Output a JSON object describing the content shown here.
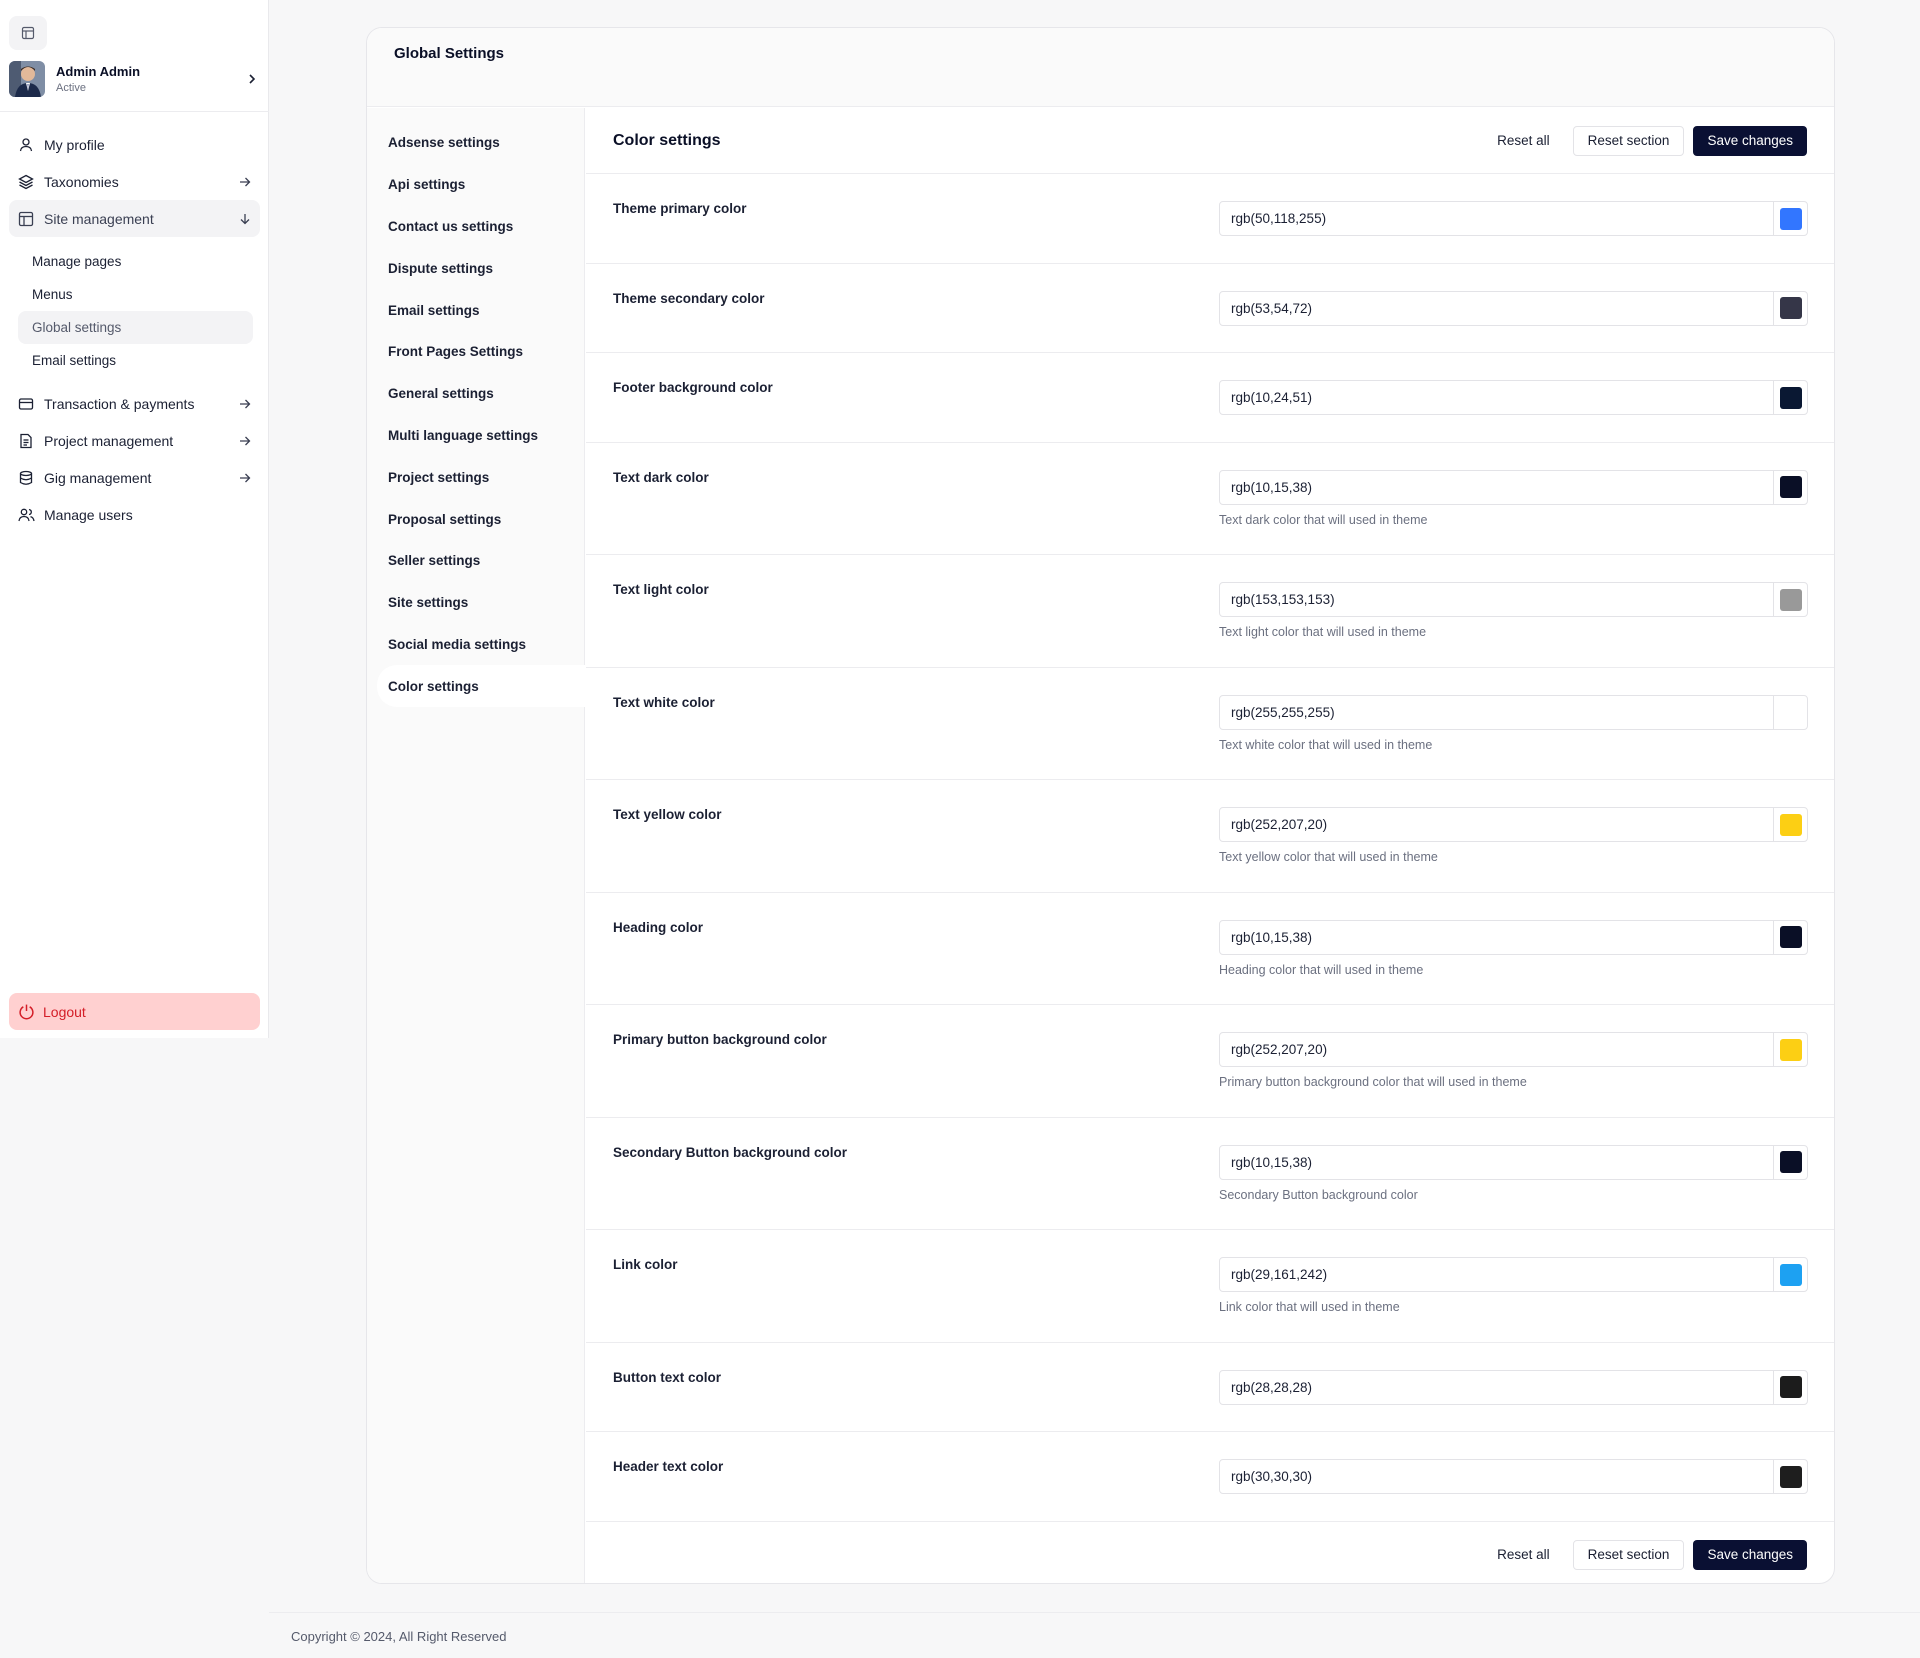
{
  "sidebar": {
    "user": {
      "name": "Admin Admin",
      "status": "Active"
    },
    "items": [
      {
        "label": "My profile",
        "icon": "user-icon"
      },
      {
        "label": "Taxonomies",
        "icon": "layers-icon"
      },
      {
        "label": "Site management",
        "icon": "layout-icon"
      },
      {
        "label": "Transaction & payments",
        "icon": "credit-card-icon"
      },
      {
        "label": "Project management",
        "icon": "document-icon"
      },
      {
        "label": "Gig management",
        "icon": "database-icon"
      },
      {
        "label": "Manage users",
        "icon": "users-icon"
      }
    ],
    "subitems": [
      "Manage pages",
      "Menus",
      "Global settings",
      "Email settings"
    ],
    "logout": "Logout"
  },
  "page": {
    "title": "Global Settings"
  },
  "settings_nav": [
    "Adsense settings",
    "Api settings",
    "Contact us settings",
    "Dispute settings",
    "Email settings",
    "Front Pages Settings",
    "General settings",
    "Multi language settings",
    "Project settings",
    "Proposal settings",
    "Seller settings",
    "Site settings",
    "Social media settings",
    "Color settings"
  ],
  "section": {
    "title": "Color settings",
    "reset_all": "Reset all",
    "reset_section": "Reset section",
    "save": "Save changes"
  },
  "colors": [
    {
      "label": "Theme primary color",
      "value": "rgb(50,118,255)",
      "hex": "#3276ff",
      "hint": ""
    },
    {
      "label": "Theme secondary color",
      "value": "rgb(53,54,72)",
      "hex": "#353648",
      "hint": ""
    },
    {
      "label": "Footer background color",
      "value": "rgb(10,24,51)",
      "hex": "#0a1833",
      "hint": ""
    },
    {
      "label": "Text dark color",
      "value": "rgb(10,15,38)",
      "hex": "#0a0f26",
      "hint": "Text dark color that will used in theme"
    },
    {
      "label": "Text light color",
      "value": "rgb(153,153,153)",
      "hex": "#999999",
      "hint": "Text light color that will used in theme"
    },
    {
      "label": "Text white color",
      "value": "rgb(255,255,255)",
      "hex": "#ffffff",
      "hint": "Text white color that will used in theme"
    },
    {
      "label": "Text yellow color",
      "value": "rgb(252,207,20)",
      "hex": "#fccf14",
      "hint": "Text yellow color that will used in theme"
    },
    {
      "label": "Heading color",
      "value": "rgb(10,15,38)",
      "hex": "#0a0f26",
      "hint": "Heading color that will used in theme"
    },
    {
      "label": "Primary button background color",
      "value": "rgb(252,207,20)",
      "hex": "#fccf14",
      "hint": "Primary button background color that will used in theme"
    },
    {
      "label": "Secondary Button background color",
      "value": "rgb(10,15,38)",
      "hex": "#0a0f26",
      "hint": "Secondary Button background color"
    },
    {
      "label": "Link color",
      "value": "rgb(29,161,242)",
      "hex": "#1da1f2",
      "hint": "Link color that will used in theme"
    },
    {
      "label": "Button text color",
      "value": "rgb(28,28,28)",
      "hex": "#1c1c1c",
      "hint": ""
    },
    {
      "label": "Header text color",
      "value": "rgb(30,30,30)",
      "hex": "#1e1e1e",
      "hint": ""
    }
  ],
  "footer": {
    "copyright": "Copyright © 2024, All Right Reserved"
  }
}
